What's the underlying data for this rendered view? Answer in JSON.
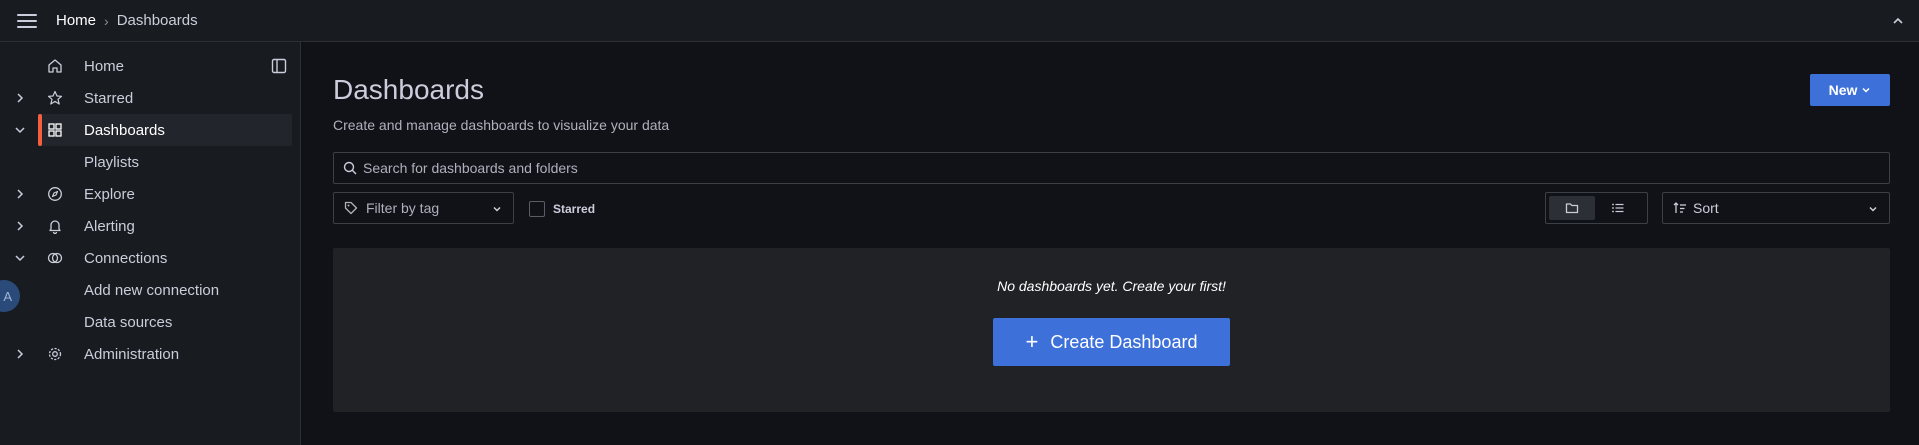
{
  "topbar": {
    "breadcrumb_home": "Home",
    "breadcrumb_separator": "›",
    "breadcrumb_current": "Dashboards"
  },
  "sidebar": {
    "items": [
      {
        "label": "Home",
        "icon": "home-icon"
      },
      {
        "label": "Starred",
        "icon": "star-icon",
        "expandable": true
      },
      {
        "label": "Dashboards",
        "icon": "grid-icon",
        "expanded": true,
        "active": true
      },
      {
        "label": "Playlists"
      },
      {
        "label": "Explore",
        "icon": "compass-icon",
        "expandable": true
      },
      {
        "label": "Alerting",
        "icon": "bell-icon",
        "expandable": true
      },
      {
        "label": "Connections",
        "icon": "connections-icon",
        "expanded": true
      },
      {
        "label": "Add new connection"
      },
      {
        "label": "Data sources"
      },
      {
        "label": "Administration",
        "icon": "cog-icon",
        "expandable": true
      }
    ],
    "avatar_letter": "A"
  },
  "main": {
    "title": "Dashboards",
    "subtitle": "Create and manage dashboards to visualize your data",
    "new_button": "New",
    "search_placeholder": "Search for dashboards and folders",
    "filter_tag_label": "Filter by tag",
    "starred_label": "Starred",
    "sort_label": "Sort",
    "empty_message": "No dashboards yet. Create your first!",
    "create_button": "Create Dashboard",
    "create_button_icon": "+"
  },
  "colors": {
    "accent": "#3d71d9",
    "active_indicator": "#f55f3e",
    "background": "#111217",
    "panel": "#181b1f"
  }
}
